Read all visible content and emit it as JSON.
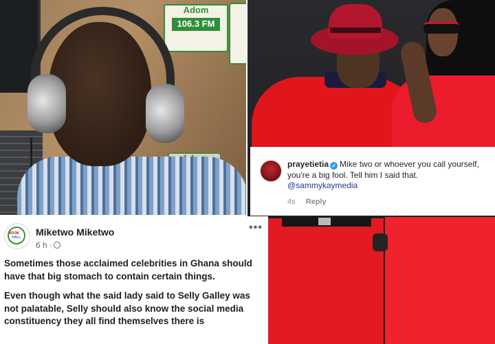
{
  "left_photo": {
    "signs": {
      "top_brand": "Adom",
      "top_frequency": "106.3 FM",
      "lower_brand": "Adom"
    }
  },
  "instagram_comment": {
    "username": "prayetietia",
    "verified": true,
    "text": "Mike two or whoever you call yourself, you're a big fool. Tell him I said that.",
    "mention": "@sammykaymedia",
    "time": "4s",
    "reply_label": "Reply"
  },
  "facebook_post": {
    "author": "Miketwo Miketwo",
    "time": "6 h ·",
    "more_label": "•••",
    "avatar_text_line1": "ADOM",
    "avatar_text_line2": "HALL",
    "paragraphs": [
      "Sometimes those acclaimed celebrities in Ghana should have that big stomach to contain certain things.",
      "Even though what the said lady said to Selly Galley was not palatable, Selly should also know the social media constituency they all find themselves there is"
    ]
  },
  "colors": {
    "instagram_verified": "#3897f0",
    "mention": "#1e3a8a",
    "red_outfit": "#e31a22",
    "adom_green": "#2f8f3a"
  }
}
